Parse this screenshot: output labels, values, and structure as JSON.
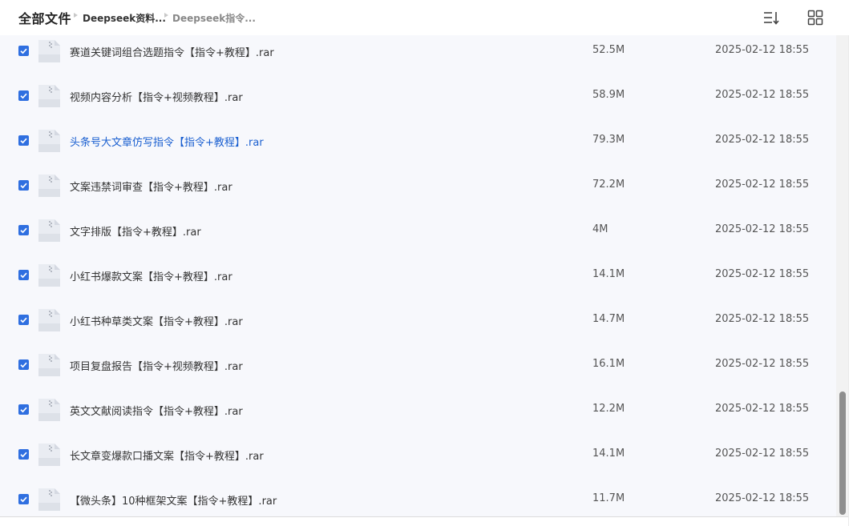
{
  "breadcrumb": {
    "root": "全部文件",
    "level1": "Deepseek资料...",
    "level2": "Deepseek指令..."
  },
  "toolbar": {
    "sort_icon": "sort-icon",
    "grid_icon": "grid-view-icon"
  },
  "colors": {
    "accent": "#2f6fe0",
    "link": "#1a5fd0",
    "list_bg": "#f7f8fc"
  },
  "files": [
    {
      "name": "赛道关键词组合选题指令【指令+教程】.rar",
      "size": "52.5M",
      "date": "2025-02-12 18:55",
      "checked": true
    },
    {
      "name": "视频内容分析【指令+视频教程】.rar",
      "size": "58.9M",
      "date": "2025-02-12 18:55",
      "checked": true
    },
    {
      "name": "头条号大文章仿写指令【指令+教程】.rar",
      "size": "79.3M",
      "date": "2025-02-12 18:55",
      "checked": true,
      "active": true
    },
    {
      "name": "文案违禁词审查【指令+教程】.rar",
      "size": "72.2M",
      "date": "2025-02-12 18:55",
      "checked": true
    },
    {
      "name": "文字排版【指令+教程】.rar",
      "size": "4M",
      "date": "2025-02-12 18:55",
      "checked": true
    },
    {
      "name": "小红书爆款文案【指令+教程】.rar",
      "size": "14.1M",
      "date": "2025-02-12 18:55",
      "checked": true
    },
    {
      "name": "小红书种草类文案【指令+教程】.rar",
      "size": "14.7M",
      "date": "2025-02-12 18:55",
      "checked": true
    },
    {
      "name": "项目复盘报告【指令+视频教程】.rar",
      "size": "16.1M",
      "date": "2025-02-12 18:55",
      "checked": true
    },
    {
      "name": "英文文献阅读指令【指令+教程】.rar",
      "size": "12.2M",
      "date": "2025-02-12 18:55",
      "checked": true
    },
    {
      "name": "长文章变爆款口播文案【指令+教程】.rar",
      "size": "14.1M",
      "date": "2025-02-12 18:55",
      "checked": true
    },
    {
      "name": "【微头条】10种框架文案【指令+教程】.rar",
      "size": "11.7M",
      "date": "2025-02-12 18:55",
      "checked": true
    }
  ]
}
